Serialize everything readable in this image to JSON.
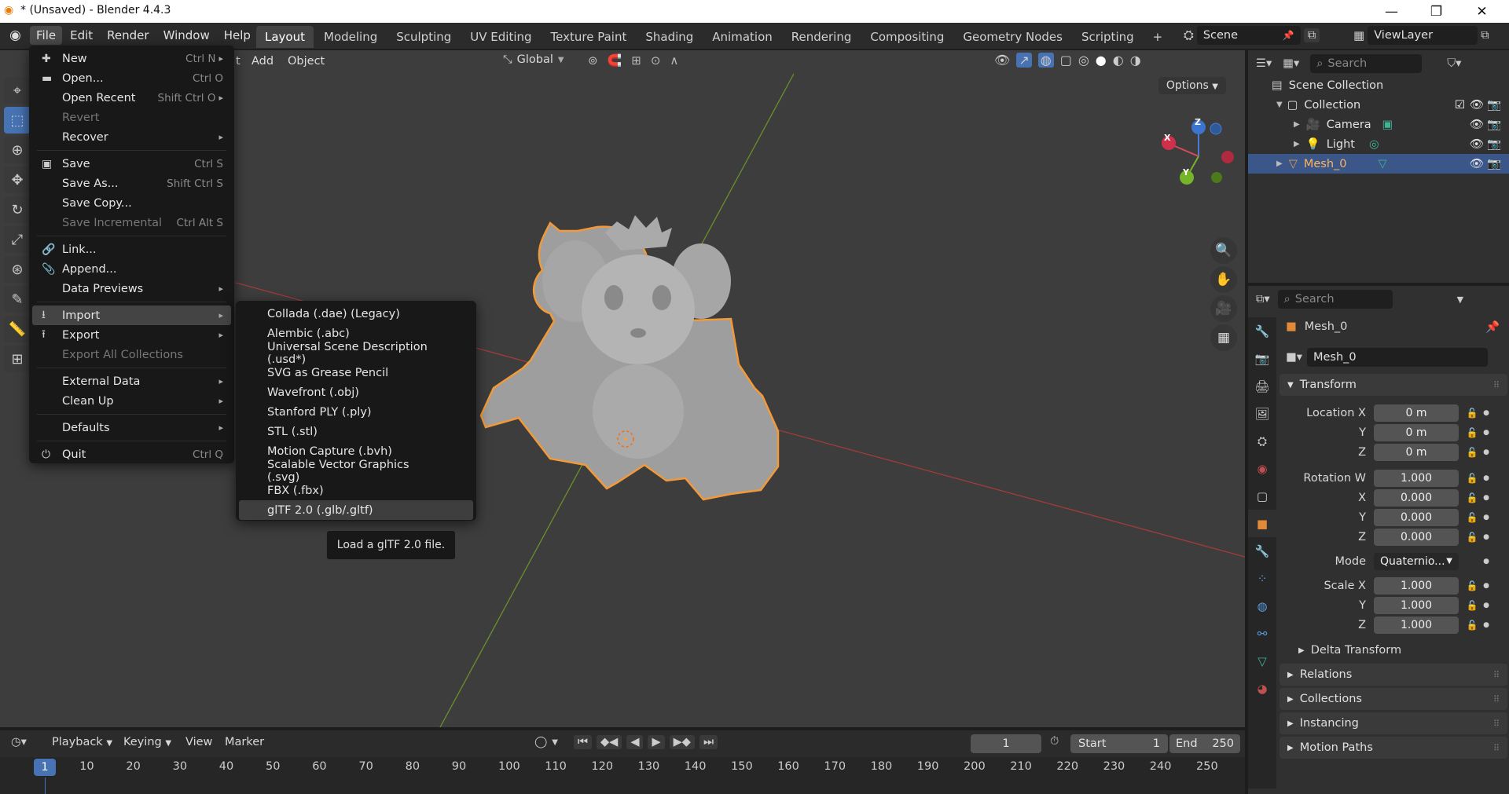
{
  "window": {
    "title": "* (Unsaved) - Blender 4.4.3",
    "minimize": "—",
    "maximize": "❐",
    "close": "✕"
  },
  "menubar": [
    "File",
    "Edit",
    "Render",
    "Window",
    "Help"
  ],
  "workspaces": [
    "Layout",
    "Modeling",
    "Sculpting",
    "UV Editing",
    "Texture Paint",
    "Shading",
    "Animation",
    "Rendering",
    "Compositing",
    "Geometry Nodes",
    "Scripting"
  ],
  "add_workspace": "+",
  "scene": {
    "name": "Scene",
    "view_layer": "ViewLayer"
  },
  "viewport": {
    "header_partial": "t",
    "add": "Add",
    "object": "Object",
    "orientation": "Global",
    "options": "Options"
  },
  "gizmo": {
    "x": "X",
    "y": "Y",
    "z": "Z"
  },
  "file_menu": [
    {
      "icon": "✚",
      "label": "New",
      "shortcut": "Ctrl N",
      "arrow": "▸"
    },
    {
      "icon": "▬",
      "label": "Open...",
      "shortcut": "Ctrl O"
    },
    {
      "icon": "",
      "label": "Open Recent",
      "shortcut": "Shift Ctrl O",
      "arrow": "▸"
    },
    {
      "icon": "",
      "label": "Revert",
      "disabled": true
    },
    {
      "icon": "",
      "label": "Recover",
      "arrow": "▸"
    },
    {
      "sep": true
    },
    {
      "icon": "▣",
      "label": "Save",
      "shortcut": "Ctrl S"
    },
    {
      "icon": "",
      "label": "Save As...",
      "shortcut": "Shift Ctrl S"
    },
    {
      "icon": "",
      "label": "Save Copy..."
    },
    {
      "icon": "",
      "label": "Save Incremental",
      "shortcut": "Ctrl Alt S",
      "disabled": true
    },
    {
      "sep": true
    },
    {
      "icon": "🔗",
      "label": "Link..."
    },
    {
      "icon": "📎",
      "label": "Append..."
    },
    {
      "icon": "",
      "label": "Data Previews",
      "arrow": "▸"
    },
    {
      "sep": true
    },
    {
      "icon": "⭳",
      "label": "Import",
      "arrow": "▸",
      "highlight": true
    },
    {
      "icon": "⭱",
      "label": "Export",
      "arrow": "▸"
    },
    {
      "icon": "",
      "label": "Export All Collections",
      "disabled": true
    },
    {
      "sep": true
    },
    {
      "icon": "",
      "label": "External Data",
      "arrow": "▸"
    },
    {
      "icon": "",
      "label": "Clean Up",
      "arrow": "▸"
    },
    {
      "sep": true
    },
    {
      "icon": "",
      "label": "Defaults",
      "arrow": "▸"
    },
    {
      "sep": true
    },
    {
      "icon": "⏻",
      "label": "Quit",
      "shortcut": "Ctrl Q"
    }
  ],
  "import_menu": [
    "Collada (.dae) (Legacy)",
    "Alembic (.abc)",
    "Universal Scene Description (.usd*)",
    "SVG as Grease Pencil",
    "Wavefront (.obj)",
    "Stanford PLY (.ply)",
    "STL (.stl)",
    "Motion Capture (.bvh)",
    "Scalable Vector Graphics (.svg)",
    "FBX (.fbx)",
    "glTF 2.0 (.glb/.gltf)"
  ],
  "tooltip": "Load a glTF 2.0 file.",
  "outliner": {
    "search": "Search",
    "root": "Scene Collection",
    "collection": "Collection",
    "items": [
      "Camera",
      "Light",
      "Mesh_0"
    ]
  },
  "properties": {
    "search": "Search",
    "object_name": "Mesh_0",
    "data_name": "Mesh_0",
    "transform": "Transform",
    "location_label": "Location X",
    "loc": [
      "0 m",
      "0 m",
      "0 m"
    ],
    "rotation_label": "Rotation W",
    "rot": [
      "1.000",
      "0.000",
      "0.000",
      "0.000"
    ],
    "mode_label": "Mode",
    "mode": "Quaternio...",
    "scale_label": "Scale X",
    "scale": [
      "1.000",
      "1.000",
      "1.000"
    ],
    "axes": [
      "Y",
      "Z",
      "X"
    ],
    "delta": "Delta Transform",
    "panels": [
      "Relations",
      "Collections",
      "Instancing",
      "Motion Paths"
    ]
  },
  "timeline": {
    "playback": "Playback",
    "keying": "Keying",
    "view": "View",
    "marker": "Marker",
    "current": "1",
    "start_label": "Start",
    "start": "1",
    "end_label": "End",
    "end": "250",
    "ticks": [
      "1",
      "10",
      "20",
      "30",
      "40",
      "50",
      "60",
      "70",
      "80",
      "90",
      "100",
      "110",
      "120",
      "130",
      "140",
      "150",
      "160",
      "170",
      "180",
      "190",
      "200",
      "210",
      "220",
      "230",
      "240",
      "250"
    ]
  }
}
